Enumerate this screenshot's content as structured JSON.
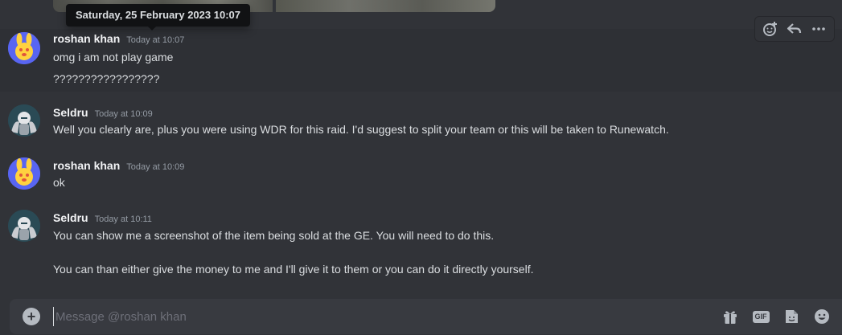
{
  "tooltip": {
    "text": "Saturday, 25 February 2023 10:07"
  },
  "messages": [
    {
      "username": "roshan khan",
      "timestamp": "Today at 10:07",
      "lines": [
        "omg i am not play game",
        "?????????????????"
      ]
    },
    {
      "username": "Seldru",
      "timestamp": "Today at 10:09",
      "lines": [
        "Well you clearly are, plus you were using WDR for this raid. I'd suggest to split your team or this will be taken to Runewatch."
      ]
    },
    {
      "username": "roshan khan",
      "timestamp": "Today at 10:09",
      "lines": [
        "ok"
      ]
    },
    {
      "username": "Seldru",
      "timestamp": "Today at 10:11",
      "lines": [
        "You can show me a screenshot of the item being sold at the GE. You will need to do this.",
        "You can than either give the money to me and I'll give it to them or you can do it directly yourself."
      ]
    }
  ],
  "message_actions": {
    "icons": [
      "add-reaction-icon",
      "reply-icon",
      "more-options-icon"
    ]
  },
  "composer": {
    "placeholder": "Message @roshan khan",
    "gif_label": "GIF",
    "icons": [
      "add-attachment-icon",
      "gift-icon",
      "gif-icon",
      "sticker-icon",
      "emoji-icon"
    ]
  },
  "colors": {
    "background": "#313338",
    "hover": "#2e3035",
    "composer": "#383a40",
    "accent": "#5865f2"
  }
}
